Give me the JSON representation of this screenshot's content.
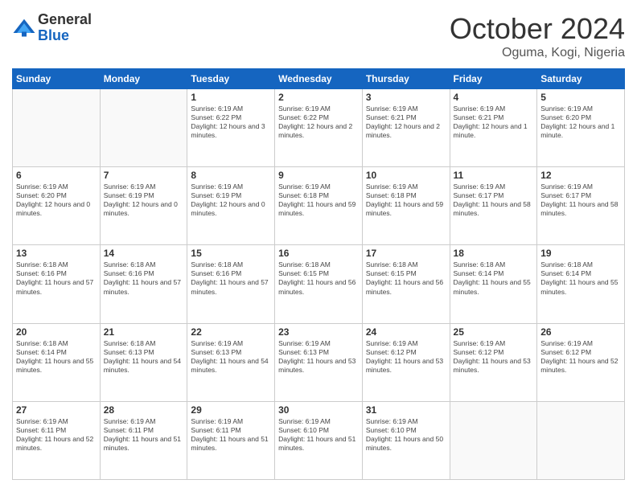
{
  "logo": {
    "general": "General",
    "blue": "Blue"
  },
  "header": {
    "month": "October 2024",
    "location": "Oguma, Kogi, Nigeria"
  },
  "days_of_week": [
    "Sunday",
    "Monday",
    "Tuesday",
    "Wednesday",
    "Thursday",
    "Friday",
    "Saturday"
  ],
  "weeks": [
    [
      {
        "day": "",
        "sunrise": "",
        "sunset": "",
        "daylight": ""
      },
      {
        "day": "",
        "sunrise": "",
        "sunset": "",
        "daylight": ""
      },
      {
        "day": "1",
        "sunrise": "Sunrise: 6:19 AM",
        "sunset": "Sunset: 6:22 PM",
        "daylight": "Daylight: 12 hours and 3 minutes."
      },
      {
        "day": "2",
        "sunrise": "Sunrise: 6:19 AM",
        "sunset": "Sunset: 6:22 PM",
        "daylight": "Daylight: 12 hours and 2 minutes."
      },
      {
        "day": "3",
        "sunrise": "Sunrise: 6:19 AM",
        "sunset": "Sunset: 6:21 PM",
        "daylight": "Daylight: 12 hours and 2 minutes."
      },
      {
        "day": "4",
        "sunrise": "Sunrise: 6:19 AM",
        "sunset": "Sunset: 6:21 PM",
        "daylight": "Daylight: 12 hours and 1 minute."
      },
      {
        "day": "5",
        "sunrise": "Sunrise: 6:19 AM",
        "sunset": "Sunset: 6:20 PM",
        "daylight": "Daylight: 12 hours and 1 minute."
      }
    ],
    [
      {
        "day": "6",
        "sunrise": "Sunrise: 6:19 AM",
        "sunset": "Sunset: 6:20 PM",
        "daylight": "Daylight: 12 hours and 0 minutes."
      },
      {
        "day": "7",
        "sunrise": "Sunrise: 6:19 AM",
        "sunset": "Sunset: 6:19 PM",
        "daylight": "Daylight: 12 hours and 0 minutes."
      },
      {
        "day": "8",
        "sunrise": "Sunrise: 6:19 AM",
        "sunset": "Sunset: 6:19 PM",
        "daylight": "Daylight: 12 hours and 0 minutes."
      },
      {
        "day": "9",
        "sunrise": "Sunrise: 6:19 AM",
        "sunset": "Sunset: 6:18 PM",
        "daylight": "Daylight: 11 hours and 59 minutes."
      },
      {
        "day": "10",
        "sunrise": "Sunrise: 6:19 AM",
        "sunset": "Sunset: 6:18 PM",
        "daylight": "Daylight: 11 hours and 59 minutes."
      },
      {
        "day": "11",
        "sunrise": "Sunrise: 6:19 AM",
        "sunset": "Sunset: 6:17 PM",
        "daylight": "Daylight: 11 hours and 58 minutes."
      },
      {
        "day": "12",
        "sunrise": "Sunrise: 6:19 AM",
        "sunset": "Sunset: 6:17 PM",
        "daylight": "Daylight: 11 hours and 58 minutes."
      }
    ],
    [
      {
        "day": "13",
        "sunrise": "Sunrise: 6:18 AM",
        "sunset": "Sunset: 6:16 PM",
        "daylight": "Daylight: 11 hours and 57 minutes."
      },
      {
        "day": "14",
        "sunrise": "Sunrise: 6:18 AM",
        "sunset": "Sunset: 6:16 PM",
        "daylight": "Daylight: 11 hours and 57 minutes."
      },
      {
        "day": "15",
        "sunrise": "Sunrise: 6:18 AM",
        "sunset": "Sunset: 6:16 PM",
        "daylight": "Daylight: 11 hours and 57 minutes."
      },
      {
        "day": "16",
        "sunrise": "Sunrise: 6:18 AM",
        "sunset": "Sunset: 6:15 PM",
        "daylight": "Daylight: 11 hours and 56 minutes."
      },
      {
        "day": "17",
        "sunrise": "Sunrise: 6:18 AM",
        "sunset": "Sunset: 6:15 PM",
        "daylight": "Daylight: 11 hours and 56 minutes."
      },
      {
        "day": "18",
        "sunrise": "Sunrise: 6:18 AM",
        "sunset": "Sunset: 6:14 PM",
        "daylight": "Daylight: 11 hours and 55 minutes."
      },
      {
        "day": "19",
        "sunrise": "Sunrise: 6:18 AM",
        "sunset": "Sunset: 6:14 PM",
        "daylight": "Daylight: 11 hours and 55 minutes."
      }
    ],
    [
      {
        "day": "20",
        "sunrise": "Sunrise: 6:18 AM",
        "sunset": "Sunset: 6:14 PM",
        "daylight": "Daylight: 11 hours and 55 minutes."
      },
      {
        "day": "21",
        "sunrise": "Sunrise: 6:18 AM",
        "sunset": "Sunset: 6:13 PM",
        "daylight": "Daylight: 11 hours and 54 minutes."
      },
      {
        "day": "22",
        "sunrise": "Sunrise: 6:19 AM",
        "sunset": "Sunset: 6:13 PM",
        "daylight": "Daylight: 11 hours and 54 minutes."
      },
      {
        "day": "23",
        "sunrise": "Sunrise: 6:19 AM",
        "sunset": "Sunset: 6:13 PM",
        "daylight": "Daylight: 11 hours and 53 minutes."
      },
      {
        "day": "24",
        "sunrise": "Sunrise: 6:19 AM",
        "sunset": "Sunset: 6:12 PM",
        "daylight": "Daylight: 11 hours and 53 minutes."
      },
      {
        "day": "25",
        "sunrise": "Sunrise: 6:19 AM",
        "sunset": "Sunset: 6:12 PM",
        "daylight": "Daylight: 11 hours and 53 minutes."
      },
      {
        "day": "26",
        "sunrise": "Sunrise: 6:19 AM",
        "sunset": "Sunset: 6:12 PM",
        "daylight": "Daylight: 11 hours and 52 minutes."
      }
    ],
    [
      {
        "day": "27",
        "sunrise": "Sunrise: 6:19 AM",
        "sunset": "Sunset: 6:11 PM",
        "daylight": "Daylight: 11 hours and 52 minutes."
      },
      {
        "day": "28",
        "sunrise": "Sunrise: 6:19 AM",
        "sunset": "Sunset: 6:11 PM",
        "daylight": "Daylight: 11 hours and 51 minutes."
      },
      {
        "day": "29",
        "sunrise": "Sunrise: 6:19 AM",
        "sunset": "Sunset: 6:11 PM",
        "daylight": "Daylight: 11 hours and 51 minutes."
      },
      {
        "day": "30",
        "sunrise": "Sunrise: 6:19 AM",
        "sunset": "Sunset: 6:10 PM",
        "daylight": "Daylight: 11 hours and 51 minutes."
      },
      {
        "day": "31",
        "sunrise": "Sunrise: 6:19 AM",
        "sunset": "Sunset: 6:10 PM",
        "daylight": "Daylight: 11 hours and 50 minutes."
      },
      {
        "day": "",
        "sunrise": "",
        "sunset": "",
        "daylight": ""
      },
      {
        "day": "",
        "sunrise": "",
        "sunset": "",
        "daylight": ""
      }
    ]
  ]
}
